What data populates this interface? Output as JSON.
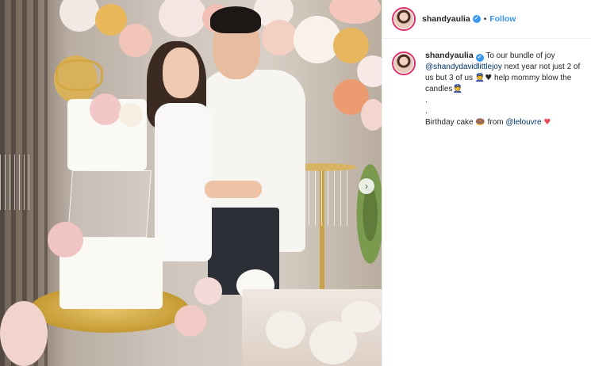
{
  "post": {
    "username": "shandyaulia",
    "separator": "•",
    "follow_label": "Follow",
    "verified_glyph": "✓"
  },
  "caption": {
    "username": "shandyaulia",
    "text_part1": "To our bundle of joy",
    "mention1": "@shandydavidlittlejoy",
    "text_part2": "next year not just 2 of us but 3 of us",
    "text_part3": "help mommy blow the candles",
    "dot1": ".",
    "dot2": ".",
    "text_part4": "Birthday cake",
    "text_part5": "from",
    "mention2": "@lelouvre",
    "emoji_face": "👮",
    "emoji_heart": "♥",
    "emoji_cake": "🍩",
    "emoji_redheart": "♥"
  },
  "photo": {
    "next_arrow": "›"
  },
  "colors": {
    "accent": "#3897f0",
    "mention": "#003569",
    "avatar_ring": "#e1306c",
    "heart_red": "#ed4956"
  },
  "icons": [
    "verified-badge-icon",
    "avatar-image",
    "carousel-next-icon",
    "police-face-emoji",
    "heart-emoji",
    "cake-emoji",
    "red-heart-emoji"
  ]
}
